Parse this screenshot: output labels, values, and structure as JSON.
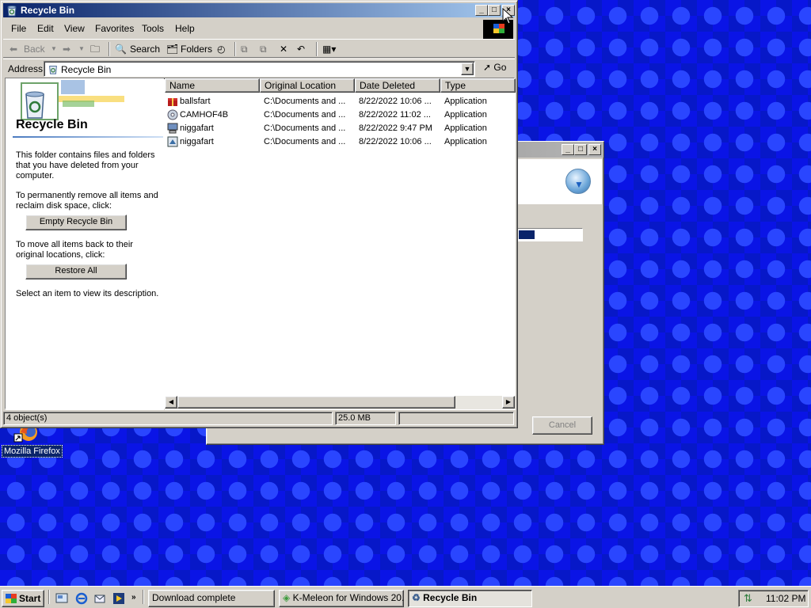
{
  "background_window": {
    "cancel_label": "Cancel",
    "progress_fraction": 0.25
  },
  "window": {
    "title": "Recycle Bin",
    "menu": [
      "File",
      "Edit",
      "View",
      "Favorites",
      "Tools",
      "Help"
    ],
    "toolbar": {
      "back_label": "Back",
      "search_label": "Search",
      "folders_label": "Folders"
    },
    "address": {
      "label": "Address",
      "value": "Recycle Bin",
      "go_label": "Go"
    },
    "left_pane": {
      "title": "Recycle Bin",
      "description": "This folder contains files and folders that you have deleted from your computer.",
      "empty_prompt": "To permanently remove all items and reclaim disk space, click:",
      "empty_button": "Empty Recycle Bin",
      "restore_prompt": "To move all items back to their original locations, click:",
      "restore_button": "Restore All",
      "select_hint": "Select an item to view its description."
    },
    "columns": [
      "Name",
      "Original Location",
      "Date Deleted",
      "Type"
    ],
    "rows": [
      {
        "name": "ballsfart",
        "location": "C:\\Documents and ...",
        "date": "8/22/2022 10:06 ...",
        "type": "Application",
        "icon": "gift-box-icon"
      },
      {
        "name": "CAMHOF4B",
        "location": "C:\\Documents and ...",
        "date": "8/22/2022 11:02 ...",
        "type": "Application",
        "icon": "cd-icon"
      },
      {
        "name": "niggafart",
        "location": "C:\\Documents and ...",
        "date": "8/22/2022 9:47 PM",
        "type": "Application",
        "icon": "computer-icon"
      },
      {
        "name": "niggafart",
        "location": "C:\\Documents and ...",
        "date": "8/22/2022 10:06 ...",
        "type": "Application",
        "icon": "installer-icon"
      }
    ],
    "status": {
      "objects": "4 object(s)",
      "size": "25.0 MB"
    }
  },
  "desktop": {
    "firefox_label": "Mozilla Firefox"
  },
  "taskbar": {
    "start_label": "Start",
    "tasks": [
      "Download complete",
      "K-Meleon for Windows 20...",
      "Recycle Bin"
    ],
    "clock": "11:02 PM"
  },
  "colors": {
    "title_active": "#0a246a",
    "desktop_blue": "#0a14e6",
    "face": "#d4d0c8"
  }
}
